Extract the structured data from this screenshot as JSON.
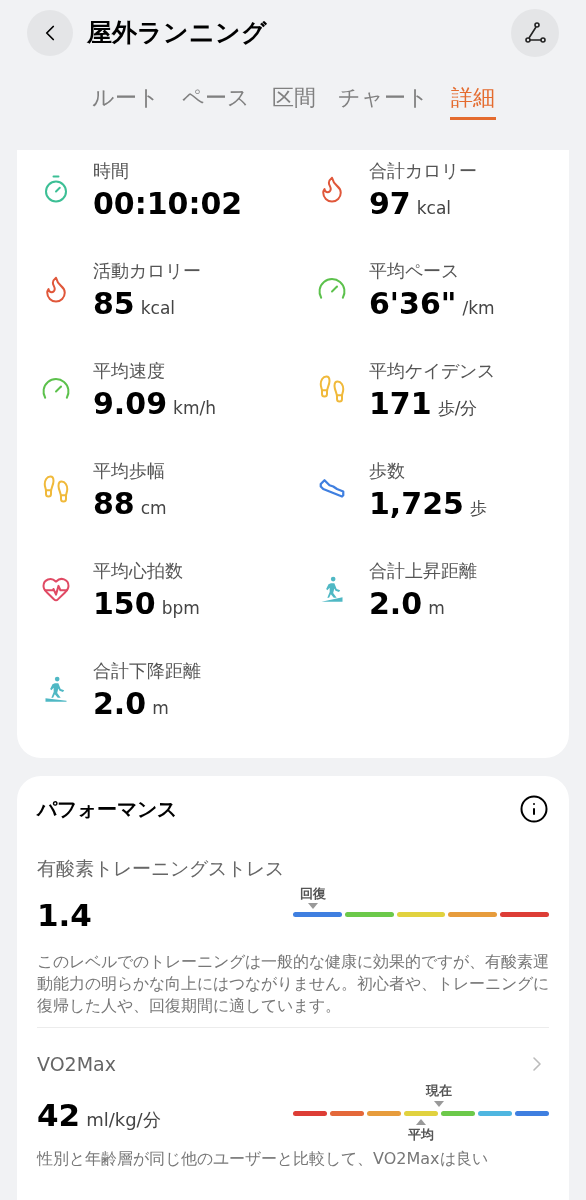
{
  "header": {
    "title": "屋外ランニング"
  },
  "tabs": [
    {
      "label": "ルート",
      "selected": false
    },
    {
      "label": "ペース",
      "selected": false
    },
    {
      "label": "区間",
      "selected": false
    },
    {
      "label": "チャート",
      "selected": false
    },
    {
      "label": "詳細",
      "selected": true
    }
  ],
  "metrics": [
    {
      "kind": "timer",
      "label": "時間",
      "value": "00:10:02"
    },
    {
      "kind": "total_calories",
      "label": "合計カロリー",
      "value": "97",
      "unit": "kcal"
    },
    {
      "kind": "active_calories",
      "label": "活動カロリー",
      "value": "85",
      "unit": "kcal"
    },
    {
      "kind": "pace",
      "label": "平均ペース",
      "value": "6'36\"",
      "unit": "/km"
    },
    {
      "kind": "speed",
      "label": "平均速度",
      "value": "9.09",
      "unit": "km/h"
    },
    {
      "kind": "cadence",
      "label": "平均ケイデンス",
      "value": "171",
      "unit": "歩/分"
    },
    {
      "kind": "stride",
      "label": "平均歩幅",
      "value": "88",
      "unit": "cm"
    },
    {
      "kind": "steps",
      "label": "歩数",
      "value": "1,725",
      "unit": "歩"
    },
    {
      "kind": "heart",
      "label": "平均心拍数",
      "value": "150",
      "unit": "bpm"
    },
    {
      "kind": "ascent",
      "label": "合計上昇距離",
      "value": "2.0",
      "unit": "m"
    },
    {
      "kind": "descent",
      "label": "合計下降距離",
      "value": "2.0",
      "unit": "m"
    }
  ],
  "performance": {
    "title": "パフォーマンス",
    "training_stress": {
      "label": "有酸素トレーニングストレス",
      "value": "1.4",
      "scale": {
        "segments": [
          {
            "color": "#3f7fe0"
          },
          {
            "color": "#6cc94a"
          },
          {
            "color": "#e1d23f"
          },
          {
            "color": "#e79c3c"
          },
          {
            "color": "#dd3d36"
          }
        ],
        "marker": {
          "label": "回復"
        }
      },
      "description": "このレベルでのトレーニングは一般的な健康に効果的ですが、有酸素運動能力の明らかな向上にはつながりません。初心者や、トレーニングに復帰した人や、回復期間に適しています。"
    },
    "vo2max": {
      "label": "VO2Max",
      "value": "42",
      "unit": "ml/kg/分",
      "scale": {
        "segments": [
          {
            "color": "#dd3d36"
          },
          {
            "color": "#e4683a"
          },
          {
            "color": "#e79c3c"
          },
          {
            "color": "#e1d23f"
          },
          {
            "color": "#6cc94a"
          },
          {
            "color": "#4fb6e0"
          },
          {
            "color": "#3f7fe0"
          }
        ],
        "current": {
          "label": "現在"
        },
        "average": {
          "label": "平均"
        }
      },
      "description": "性別と年齢層が同じ他のユーザーと比較して、VO2Maxは良い"
    }
  }
}
